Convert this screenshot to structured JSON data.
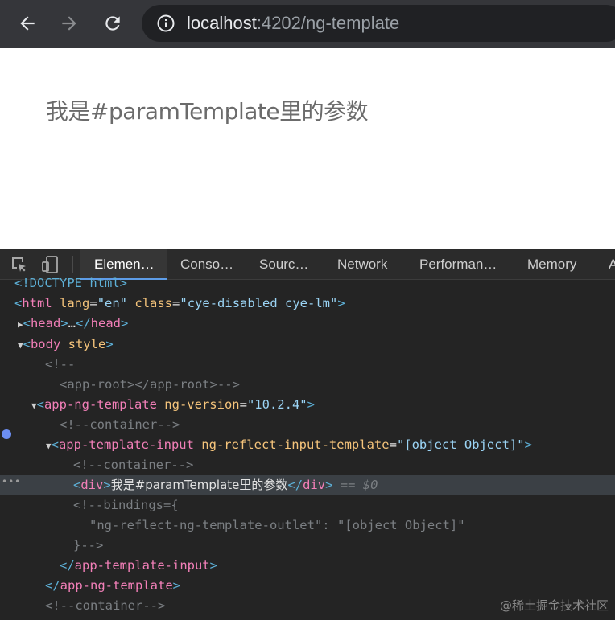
{
  "browser": {
    "url_host": "localhost",
    "url_path": ":4202/ng-template"
  },
  "page": {
    "text": "我是#paramTemplate里的参数"
  },
  "devtools": {
    "tabs": [
      {
        "label": "Elemen…"
      },
      {
        "label": "Conso…"
      },
      {
        "label": "Sourc…"
      },
      {
        "label": "Network"
      },
      {
        "label": "Performan…"
      },
      {
        "label": "Memory"
      },
      {
        "label": "A"
      }
    ],
    "dom": {
      "l0": {
        "open": "<!DOCTYPE html>"
      },
      "l1": {
        "tag": "html",
        "a1n": "lang",
        "a1v": "\"en\"",
        "a2n": "class",
        "a2v": "\"cye-disabled cye-lm\""
      },
      "l2": {
        "tag": "head",
        "ellipsis": "…",
        "close": "head"
      },
      "l3": {
        "tag": "body",
        "a1n": "style"
      },
      "l4": {
        "text": "<!--"
      },
      "l5": {
        "text": "<app-root></app-root>-->"
      },
      "l6": {
        "tag": "app-ng-template",
        "a1n": "ng-version",
        "a1v": "\"10.2.4\""
      },
      "l7": {
        "text": "<!--container-->"
      },
      "l8": {
        "tag": "app-template-input",
        "a1n": "ng-reflect-input-template",
        "a1v": "\"[object Object]\""
      },
      "l9": {
        "text": "<!--container-->"
      },
      "l10": {
        "tag": "div",
        "content": "我是#paramTemplate里的参数",
        "close": "div",
        "marker": "== $0"
      },
      "l11": {
        "text": "<!--bindings={"
      },
      "l12": {
        "text": "\"ng-reflect-ng-template-outlet\": \"[object Object]\""
      },
      "l13": {
        "text": "}-->"
      },
      "l14": {
        "close": "app-template-input"
      },
      "l15": {
        "close": "app-ng-template"
      },
      "l16": {
        "text": "<!--container-->"
      }
    }
  },
  "watermark": "@稀土掘金技术社区"
}
